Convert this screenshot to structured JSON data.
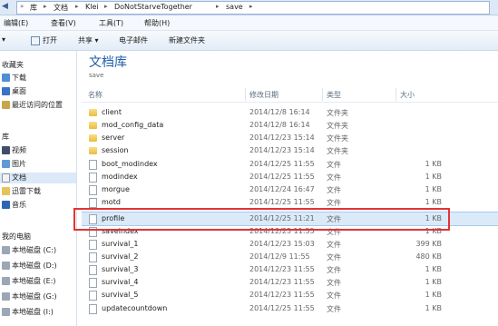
{
  "address": {
    "crumbs": [
      "库",
      "文档",
      "Klei",
      "DoNotStarveTogether",
      "save"
    ]
  },
  "menubar": {
    "items": [
      "编辑(E)",
      "查看(V)",
      "工具(T)",
      "帮助(H)"
    ]
  },
  "toolbar": {
    "items": [
      "打开",
      "共享 ▾",
      "电子邮件",
      "新建文件夹"
    ]
  },
  "navpane": {
    "favorites_head": "收藏夹",
    "favorites": [
      "下载",
      "桌面",
      "最近访问的位置"
    ],
    "library_head": "库",
    "libraries": [
      "视频",
      "图片",
      "文档",
      "迅雷下载",
      "音乐"
    ],
    "computer_head": "我的电脑",
    "drives": [
      "本地磁盘 (C:)",
      "本地磁盘 (D:)",
      "本地磁盘 (E:)",
      "本地磁盘 (G:)",
      "本地磁盘 (I:)"
    ]
  },
  "library": {
    "title": "文档库",
    "subtitle": "save"
  },
  "columns": [
    "名称",
    "修改日期",
    "类型",
    "大小"
  ],
  "files": [
    {
      "name": "client",
      "date": "2014/12/8 16:14",
      "type": "文件夹",
      "size": "",
      "kind": "folder"
    },
    {
      "name": "mod_config_data",
      "date": "2014/12/8 16:14",
      "type": "文件夹",
      "size": "",
      "kind": "folder"
    },
    {
      "name": "server",
      "date": "2014/12/23 15:14",
      "type": "文件夹",
      "size": "",
      "kind": "folder"
    },
    {
      "name": "session",
      "date": "2014/12/23 15:14",
      "type": "文件夹",
      "size": "",
      "kind": "folder"
    },
    {
      "name": "boot_modindex",
      "date": "2014/12/25 11:55",
      "type": "文件",
      "size": "1 KB",
      "kind": "file"
    },
    {
      "name": "modindex",
      "date": "2014/12/25 11:55",
      "type": "文件",
      "size": "1 KB",
      "kind": "file"
    },
    {
      "name": "morgue",
      "date": "2014/12/24 16:47",
      "type": "文件",
      "size": "1 KB",
      "kind": "file"
    },
    {
      "name": "motd",
      "date": "2014/12/25 11:55",
      "type": "文件",
      "size": "1 KB",
      "kind": "file"
    },
    {
      "name": "profile",
      "date": "2014/12/25 11:21",
      "type": "文件",
      "size": "1 KB",
      "kind": "file"
    },
    {
      "name": "saveindex",
      "date": "2014/12/25 11:55",
      "type": "文件",
      "size": "1 KB",
      "kind": "file"
    },
    {
      "name": "survival_1",
      "date": "2014/12/23 15:03",
      "type": "文件",
      "size": "399 KB",
      "kind": "file"
    },
    {
      "name": "survival_2",
      "date": "2014/12/9 11:55",
      "type": "文件",
      "size": "480 KB",
      "kind": "file"
    },
    {
      "name": "survival_3",
      "date": "2014/12/23 11:55",
      "type": "文件",
      "size": "1 KB",
      "kind": "file"
    },
    {
      "name": "survival_4",
      "date": "2014/12/23 11:55",
      "type": "文件",
      "size": "1 KB",
      "kind": "file"
    },
    {
      "name": "survival_5",
      "date": "2014/12/23 11:55",
      "type": "文件",
      "size": "1 KB",
      "kind": "file"
    },
    {
      "name": "updatecountdown",
      "date": "2014/12/25 11:55",
      "type": "文件",
      "size": "1 KB",
      "kind": "file"
    }
  ],
  "selected_file": "profile",
  "colors": {
    "title_blue": "#1e5da8",
    "highlight_red": "#e03535",
    "folder_yellow": "#e9bd3e"
  }
}
